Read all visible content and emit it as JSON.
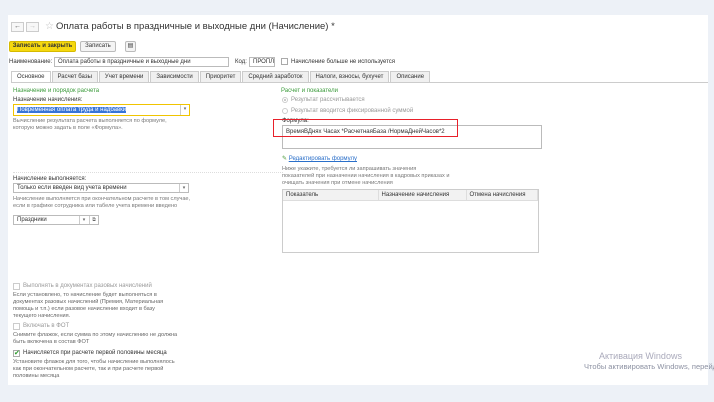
{
  "header": {
    "back": "←",
    "forward": "→",
    "star": "☆",
    "title": "Оплата работы в праздничные и выходные дни (Начисление) *"
  },
  "toolbar": {
    "save_close": "Записать и закрыть",
    "save": "Записать",
    "doc_icon": "document-icon"
  },
  "name_row": {
    "name_label": "Наименование:",
    "name_value": "Оплата работы в праздничные и выходные дни",
    "code_label": "Код:",
    "code_value": "ПРОПЛ",
    "unused_label": "Начисление больше не используется",
    "unused_checked": false
  },
  "tabs": [
    "Основное",
    "Расчет базы",
    "Учет времени",
    "Зависимости",
    "Приоритет",
    "Средний заработок",
    "Налоги, взносы, бухучет",
    "Описание"
  ],
  "left": {
    "section_title": "Назначение и порядок расчета",
    "purpose_label": "Назначение начисления:",
    "purpose_value": "Повременная оплата труда и надбавки",
    "purpose_hint": [
      "Вычисление результата расчета выполняется по формуле,",
      "которую можно задать в поле «Формула»."
    ],
    "performed_label": "Начисление выполняется:",
    "performed_value": "Только если введен вид учета времени",
    "performed_hint": [
      "Начисление выполняется при окончательном расчете в том случае,",
      "если в графике сотрудника или табеле учета времени введено"
    ],
    "time_type_value": "Праздники",
    "one_time_label": "Выполнять в документах разовых начислений",
    "one_time_checked": false,
    "one_time_hint": [
      "Если установлено, то начисление будет выполняться в",
      "документах разовых начислений (Премия, Материальная",
      "помощь и т.п.) если разовое начисление входит в базу",
      "текущего начисления."
    ],
    "fot_label": "Включать в ФОТ",
    "fot_checked": false,
    "fot_hint": [
      "Снимите флажок, если сумма по этому начислению не должна",
      "быть включена в состав ФОТ"
    ],
    "first_half_label": "Начисляется при расчете первой половины месяца",
    "first_half_checked": true,
    "first_half_hint": [
      "Установите флажок для того, чтобы начисление выполнялось",
      "как при окончательном расчете, так и при расчете первой",
      "половины месяца"
    ]
  },
  "right": {
    "section_title": "Расчет и показатели",
    "radio_calc": "Результат рассчитывается",
    "radio_fixed": "Результат вводится фиксированной суммой",
    "formula_label": "Формула:",
    "formula_value": "ВремяВДнях Часах *РасчетнаяБаза /НормаДнейЧасов*2",
    "edit_formula": "Редактировать формулу",
    "indicators_hint": [
      "Ниже укажите, требуется ли запрашивать значения",
      "показателей при назначении начисления в кадровых приказах и",
      "очищать значения при отмене начисления"
    ],
    "table_headers": [
      "Показатель",
      "Назначение начисления",
      "Отмена начисления"
    ],
    "highlight_color": "#e8202a"
  },
  "watermark": {
    "title": "Активация Windows",
    "subtitle": "Чтобы активировать Windows, перейд"
  }
}
